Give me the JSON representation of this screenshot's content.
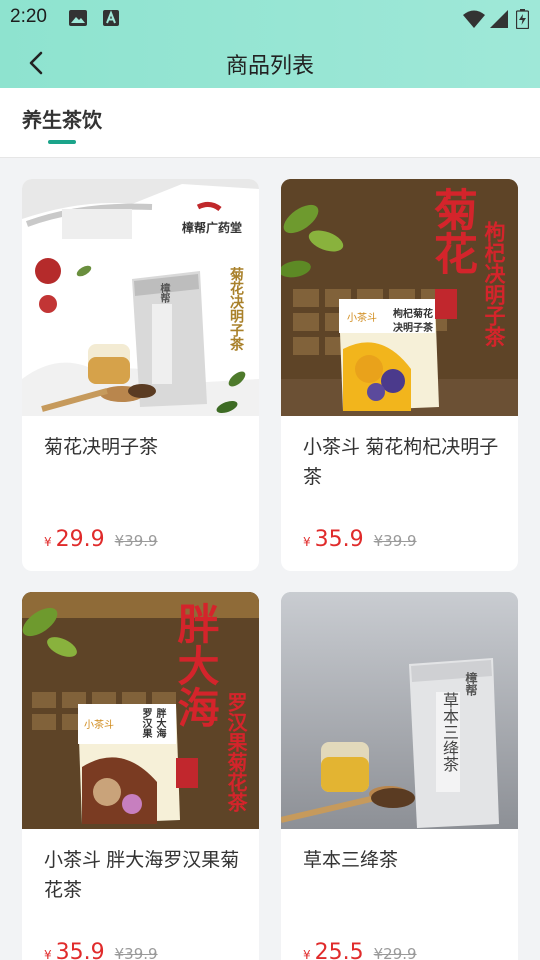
{
  "status_bar": {
    "time": "2:20"
  },
  "app_bar": {
    "title": "商品列表"
  },
  "tabs": [
    {
      "label": "养生茶饮"
    }
  ],
  "products": [
    {
      "name": "菊花决明子茶",
      "currency": "¥",
      "price": "29.9",
      "original_price": "¥39.9",
      "image_text": {
        "brand": "樟帮广药堂",
        "side": "菊花决明子茶",
        "bag": "樟帮"
      }
    },
    {
      "name": "小茶斗 菊花枸杞决明子茶",
      "currency": "¥",
      "price": "35.9",
      "original_price": "¥39.9",
      "image_text": {
        "big": "菊花",
        "side": "枸杞决明子茶",
        "box_brand": "小茶斗",
        "box_name": "决明子茶",
        "box_name2": "枸杞菊花"
      }
    },
    {
      "name": "小茶斗 胖大海罗汉果菊花茶",
      "currency": "¥",
      "price": "35.9",
      "original_price": "¥39.9",
      "image_text": {
        "big": "胖大海",
        "side": "罗汉果菊花茶",
        "box_brand": "小茶斗",
        "box_name": "胖大海",
        "box_name2": "罗汉果"
      }
    },
    {
      "name": "草本三绛茶",
      "currency": "¥",
      "price": "25.5",
      "original_price": "¥29.9",
      "image_text": {
        "bag": "樟帮",
        "bag_name": "草本三绛茶"
      }
    }
  ],
  "colors": {
    "accent": "#1ba48a",
    "price": "#e02b2b",
    "header": "#8ee3cf",
    "selection": "#e14b4b"
  }
}
